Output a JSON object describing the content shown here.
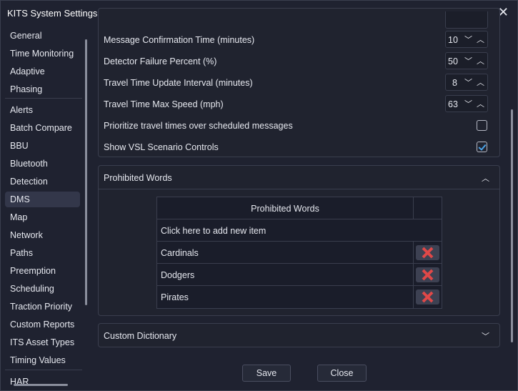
{
  "window": {
    "title": "KITS System Settings"
  },
  "sidebar": {
    "group1": [
      "General",
      "Time Monitoring",
      "Adaptive",
      "Phasing"
    ],
    "group2": [
      "Alerts",
      "Batch Compare",
      "BBU",
      "Bluetooth",
      "Detection",
      "DMS",
      "Map",
      "Network",
      "Paths",
      "Preemption",
      "Scheduling",
      "Traction Priority",
      "Custom Reports",
      "ITS Asset Types",
      "Timing Values"
    ],
    "group3": [
      "HAR"
    ],
    "active": "DMS"
  },
  "settings": {
    "message_confirmation": {
      "label": "Message Confirmation Time (minutes)",
      "value": "10"
    },
    "detector_failure": {
      "label": "Detector Failure Percent (%)",
      "value": "50"
    },
    "travel_time_interval": {
      "label": "Travel Time Update Interval (minutes)",
      "value": "8"
    },
    "travel_time_max_speed": {
      "label": "Travel Time Max Speed (mph)",
      "value": "63"
    },
    "prioritize_travel_times": {
      "label": "Prioritize travel times over scheduled messages",
      "checked": false
    },
    "show_vsl": {
      "label": "Show VSL Scenario Controls",
      "checked": true
    }
  },
  "prohibited_words": {
    "section_title": "Prohibited Words",
    "column_header": "Prohibited Words",
    "add_new": "Click here to add new item",
    "items": [
      "Cardinals",
      "Dodgers",
      "Pirates"
    ]
  },
  "custom_dictionary": {
    "section_title": "Custom Dictionary"
  },
  "footer": {
    "save_label": "Save",
    "close_label": "Close"
  },
  "colors": {
    "accent": "#4aa3e8",
    "delete": "#e04848"
  }
}
